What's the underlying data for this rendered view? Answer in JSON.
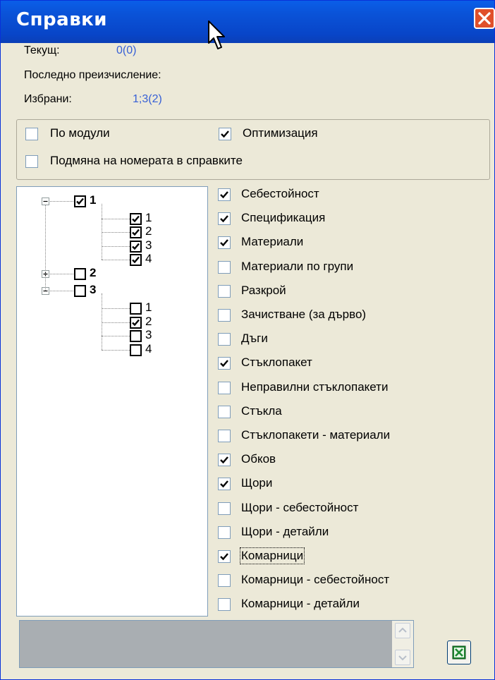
{
  "window": {
    "title": "Справки"
  },
  "info": {
    "current_label": "Текущ:",
    "current_value": "0(0)",
    "last_recalc_label": "Последно преизчисление:",
    "selected_label": "Избрани:",
    "selected_value": "1;3(2)"
  },
  "options": {
    "by_modules": {
      "label": "По модули",
      "checked": false
    },
    "optimization": {
      "label": "Оптимизация",
      "checked": true
    },
    "replace_numbers": {
      "label": "Подмяна на номерата в справките",
      "checked": false
    }
  },
  "tree": [
    {
      "label": "1",
      "checked": true,
      "expanded": true,
      "children": [
        {
          "label": "1",
          "checked": true
        },
        {
          "label": "2",
          "checked": true
        },
        {
          "label": "3",
          "checked": true
        },
        {
          "label": "4",
          "checked": true
        }
      ]
    },
    {
      "label": "2",
      "checked": false,
      "expanded": false,
      "children": []
    },
    {
      "label": "3",
      "checked": false,
      "expanded": true,
      "children": [
        {
          "label": "1",
          "checked": false
        },
        {
          "label": "2",
          "checked": true
        },
        {
          "label": "3",
          "checked": false
        },
        {
          "label": "4",
          "checked": false
        }
      ]
    }
  ],
  "reports": [
    {
      "label": "Себестойност",
      "checked": true
    },
    {
      "label": "Спецификация",
      "checked": true
    },
    {
      "label": "Материали",
      "checked": true
    },
    {
      "label": "Материали по групи",
      "checked": false
    },
    {
      "label": "Разкрой",
      "checked": false
    },
    {
      "label": "Зачистване (за дърво)",
      "checked": false
    },
    {
      "label": "Дъги",
      "checked": false
    },
    {
      "label": "Стъклопакет",
      "checked": true
    },
    {
      "label": "Неправилни стъклопакети",
      "checked": false
    },
    {
      "label": "Стъкла",
      "checked": false
    },
    {
      "label": "Стъклопакети - материали",
      "checked": false
    },
    {
      "label": "Обков",
      "checked": true
    },
    {
      "label": "Щори",
      "checked": true
    },
    {
      "label": "Щори - себестойност",
      "checked": false
    },
    {
      "label": "Щори - детайли",
      "checked": false
    },
    {
      "label": "Комарници",
      "checked": true,
      "focused": true
    },
    {
      "label": "Комарници - себестойност",
      "checked": false
    },
    {
      "label": "Комарници - детайли",
      "checked": false
    }
  ],
  "icons": {
    "close": "close-icon",
    "export": "excel-icon",
    "cursor": "mouse-cursor-icon"
  }
}
